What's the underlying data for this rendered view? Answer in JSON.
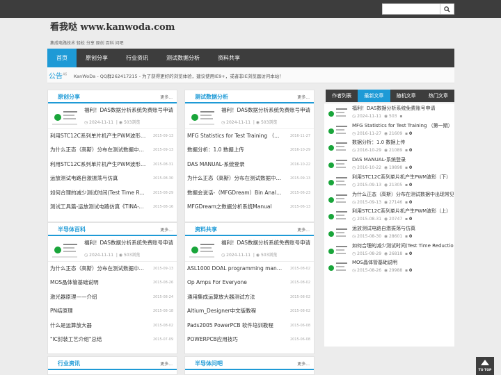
{
  "search": {
    "placeholder": "",
    "icon": "search-icon"
  },
  "site": {
    "logo": "看我哒 www.kanwoda.com",
    "slogan": "集成电路技术 轻松 分享 原创 百科 问吧"
  },
  "nav": [
    "首页",
    "原创分享",
    "行业资讯",
    "测试数据分析",
    "资料共享"
  ],
  "notice": {
    "title": "公告",
    "count": "46",
    "text": "KanWoDa - QQ群262417215 - 为了获得更好的浏览体验，建议使用IE9+，或者非IE浏览器访问本站！"
  },
  "more_label": "更多...",
  "panels": [
    {
      "title": "原创分享",
      "feature": {
        "title": "福利！DAS数据分析系统免费账号申请",
        "date": "2024-11-11",
        "views": "503浏览"
      },
      "items": [
        {
          "title": "利用STC12C系列单片机产生PWM波形（下）",
          "date": "2015-09-13"
        },
        {
          "title": "为什么正态（高斯）分布在测试数据中出现",
          "date": "2015-09-13"
        },
        {
          "title": "利用STC12C系列单片机产生PWM波形（上）",
          "date": "2015-08-31"
        },
        {
          "title": "运放测试电路自激振荡与仿真",
          "date": "2015-08-30"
        },
        {
          "title": "如何合理的减少测试时间(Test Time Reduction)",
          "date": "2015-08-29"
        },
        {
          "title": "测试工具篇-运放测试电路仿真《TINA-TI》",
          "date": "2015-08-16"
        }
      ]
    },
    {
      "title": "测试数据分析",
      "feature": {
        "title": "福利！DAS数据分析系统免费账号申请",
        "date": "2024-11-11",
        "views": "503浏览"
      },
      "items": [
        {
          "title": "MFG Statistics for Test Training （第一期）",
          "date": "2016-11-27"
        },
        {
          "title": "数据分析：1.0 数据上传",
          "date": "2016-10-29"
        },
        {
          "title": "DAS MANUAL-系统登录",
          "date": "2016-10-22"
        },
        {
          "title": "为什么正态（高斯）分布在测试数据中出现",
          "date": "2015-09-13"
        },
        {
          "title": "数据会说话-（MFGDream）Bin Analysis",
          "date": "2015-06-23"
        },
        {
          "title": "MFGDream之数据分析系统Manual",
          "date": "2015-06-13"
        }
      ]
    },
    {
      "title": "半导体百科",
      "feature": {
        "title": "福利！DAS数据分析系统免费账号申请",
        "date": "2024-11-11",
        "views": "503浏览"
      },
      "items": [
        {
          "title": "为什么正态（高斯）分布在测试数据中出现",
          "date": "2015-09-13"
        },
        {
          "title": "MOS晶体管基础说明",
          "date": "2015-08-26"
        },
        {
          "title": "激光器原理——介绍",
          "date": "2015-08-24"
        },
        {
          "title": "PN结原理",
          "date": "2015-08-18"
        },
        {
          "title": "什么是运算放大器",
          "date": "2015-08-02"
        },
        {
          "title": "\"IC封装工艺介绍\"总结",
          "date": "2015-07-09"
        }
      ]
    },
    {
      "title": "资料共享",
      "feature": {
        "title": "福利！DAS数据分析系统免费账号申请",
        "date": "2024-11-11",
        "views": "503浏览"
      },
      "items": [
        {
          "title": "ASL1000 DOAL programming manual",
          "date": "2015-08-02"
        },
        {
          "title": "Op Amps For Everyone",
          "date": "2015-08-02"
        },
        {
          "title": "通用集成运算放大器测试方法",
          "date": "2015-08-02"
        },
        {
          "title": "Altium_Designer中文版教程",
          "date": "2015-08-02"
        },
        {
          "title": "Pads2005 PowerPCB 软件培训教程",
          "date": "2015-06-08"
        },
        {
          "title": "POWERPCB应用技巧",
          "date": "2015-06-08"
        }
      ]
    },
    {
      "title": "行业资讯"
    },
    {
      "title": "半导体问吧"
    }
  ],
  "sidebar": {
    "tabs": [
      "作者列表",
      "最新文章",
      "随机文章",
      "热门文章"
    ],
    "active_tab": 1,
    "items": [
      {
        "title": "福利！DAS数据分析系统免费账号申请",
        "date": "2024-11-11",
        "views": "503",
        "comments": ""
      },
      {
        "title": "MFG Statistics for Test Training （第一期）",
        "date": "2016-11-27",
        "views": "21609",
        "comments": "0"
      },
      {
        "title": "数据分析：1.0 数据上传",
        "date": "2016-10-29",
        "views": "21089",
        "comments": "0"
      },
      {
        "title": "DAS MANUAL-系统登录",
        "date": "2016-10-22",
        "views": "19898",
        "comments": "0"
      },
      {
        "title": "利用STC12C系列单片机产生PWM波形（下）",
        "date": "2015-09-13",
        "views": "21305",
        "comments": "0"
      },
      {
        "title": "为什么正态（高斯）分布在测试数据中出现常见",
        "date": "2015-09-13",
        "views": "27146",
        "comments": "0"
      },
      {
        "title": "利用STC12C系列单片机产生PWM波形（上）",
        "date": "2015-08-31",
        "views": "20747",
        "comments": "0"
      },
      {
        "title": "运放测试电路自激振荡与仿真",
        "date": "2015-08-30",
        "views": "28601",
        "comments": "0"
      },
      {
        "title": "如何合理的减少测试时间(Test Time Reduction)",
        "date": "2015-08-29",
        "views": "26818",
        "comments": "0"
      },
      {
        "title": "MOS晶体管基础说明",
        "date": "2015-08-26",
        "views": "29988",
        "comments": "0"
      }
    ]
  },
  "totop": "TO TOP",
  "colors": {
    "accent": "#1e9ad6",
    "dark": "#3d3d3d",
    "background": "#ececec"
  }
}
